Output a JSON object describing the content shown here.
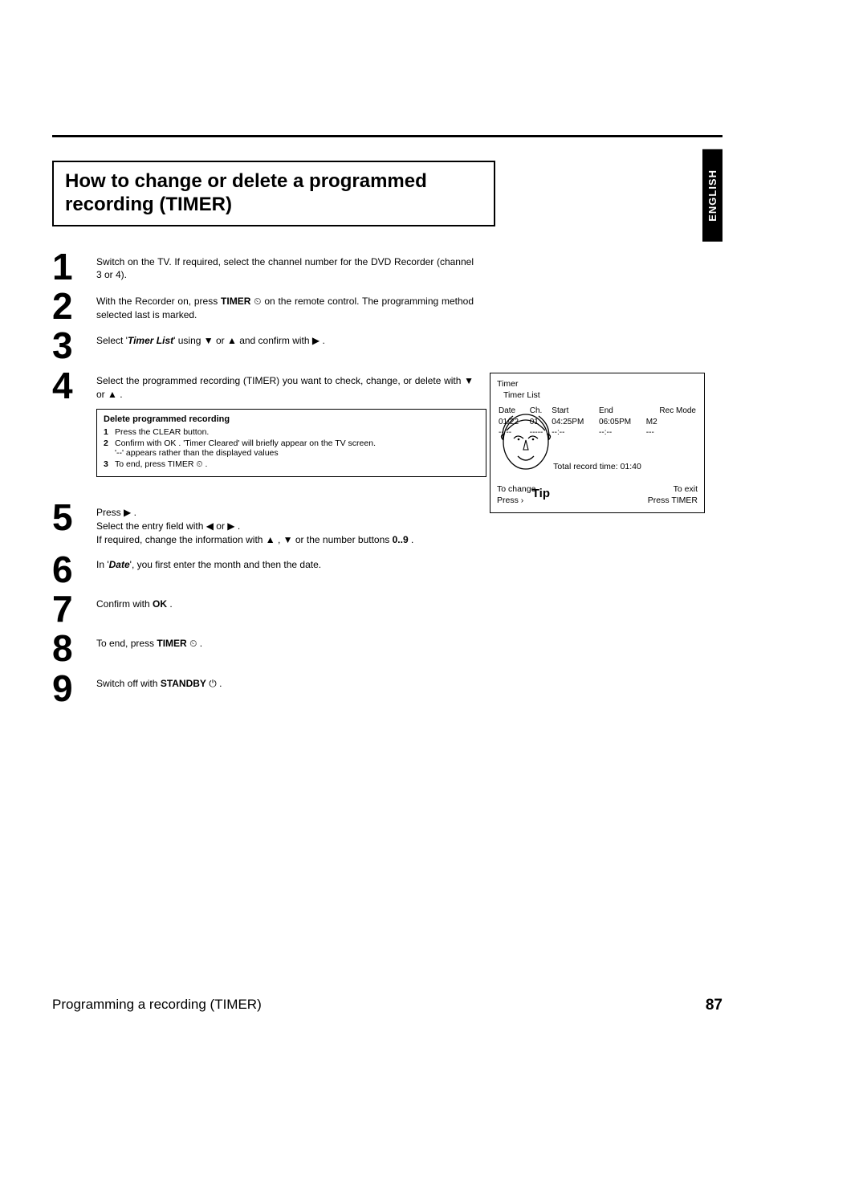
{
  "language_tab": "ENGLISH",
  "title": "How to change or delete a programmed recording (TIMER)",
  "steps": {
    "s1": "Switch on the TV. If required, select the channel number for the DVD Recorder (channel 3 or 4).",
    "s2a": "With the Recorder on, press ",
    "s2k": "TIMER",
    "s2b": " on the remote control. The programming method selected last is marked.",
    "s3a": "Select '",
    "s3k": "Timer List",
    "s3b": "' using ▼ or ▲ and confirm with ▶ .",
    "s4": "Select the programmed recording (TIMER) you want to check, change, or delete with ▼ or ▲ .",
    "s5a": "Press ▶ .",
    "s5b": "Select the entry field with ◀ or ▶ .",
    "s5c": "If required, change the information with ▲ , ▼ or the number buttons ",
    "s5d": "0..9",
    "s5e": " .",
    "s6a": "In '",
    "s6k": "Date",
    "s6b": "', you first enter the month and then the date.",
    "s7a": "Confirm with ",
    "s7k": "OK",
    "s7b": " .",
    "s8a": "To end, press ",
    "s8k": "TIMER",
    "s8b": " .",
    "s9a": "Switch off with ",
    "s9k": "STANDBY",
    "s9b": " ."
  },
  "tip": {
    "title": "Delete programmed recording",
    "r1a": "Press the ",
    "r1k": "CLEAR",
    "r1b": " button.",
    "r2a": "Confirm with ",
    "r2k": "OK",
    "r2b": " . '",
    "r2i": "Timer Cleared",
    "r2c": "' will briefly appear on the TV screen.",
    "r2d": "'--' appears rather than the displayed values",
    "r3a": "To end, press ",
    "r3k": "TIMER",
    "r3b": " .",
    "label": "Tip"
  },
  "osd": {
    "t1": "Timer",
    "t2": "Timer List",
    "hdr": {
      "date": "Date",
      "ch": "Ch.",
      "start": "Start",
      "end": "End",
      "mode": "Rec Mode"
    },
    "rows": [
      {
        "date": "01/22",
        "ch": "01",
        "start": "04:25PM",
        "end": "06:05PM",
        "mode": "M2"
      },
      {
        "date": "--/--",
        "ch": "-----",
        "start": "--:--",
        "end": "--:--",
        "mode": "---"
      }
    ],
    "total": "Total record time: 01:40",
    "foot_l1": "To change",
    "foot_l2": "Press ›",
    "foot_r1": "To exit",
    "foot_r2": "Press TIMER"
  },
  "footer": {
    "section": "Programming a recording (TIMER)",
    "page": "87"
  },
  "icons": {
    "clock": "⏲",
    "power": "⏻"
  }
}
